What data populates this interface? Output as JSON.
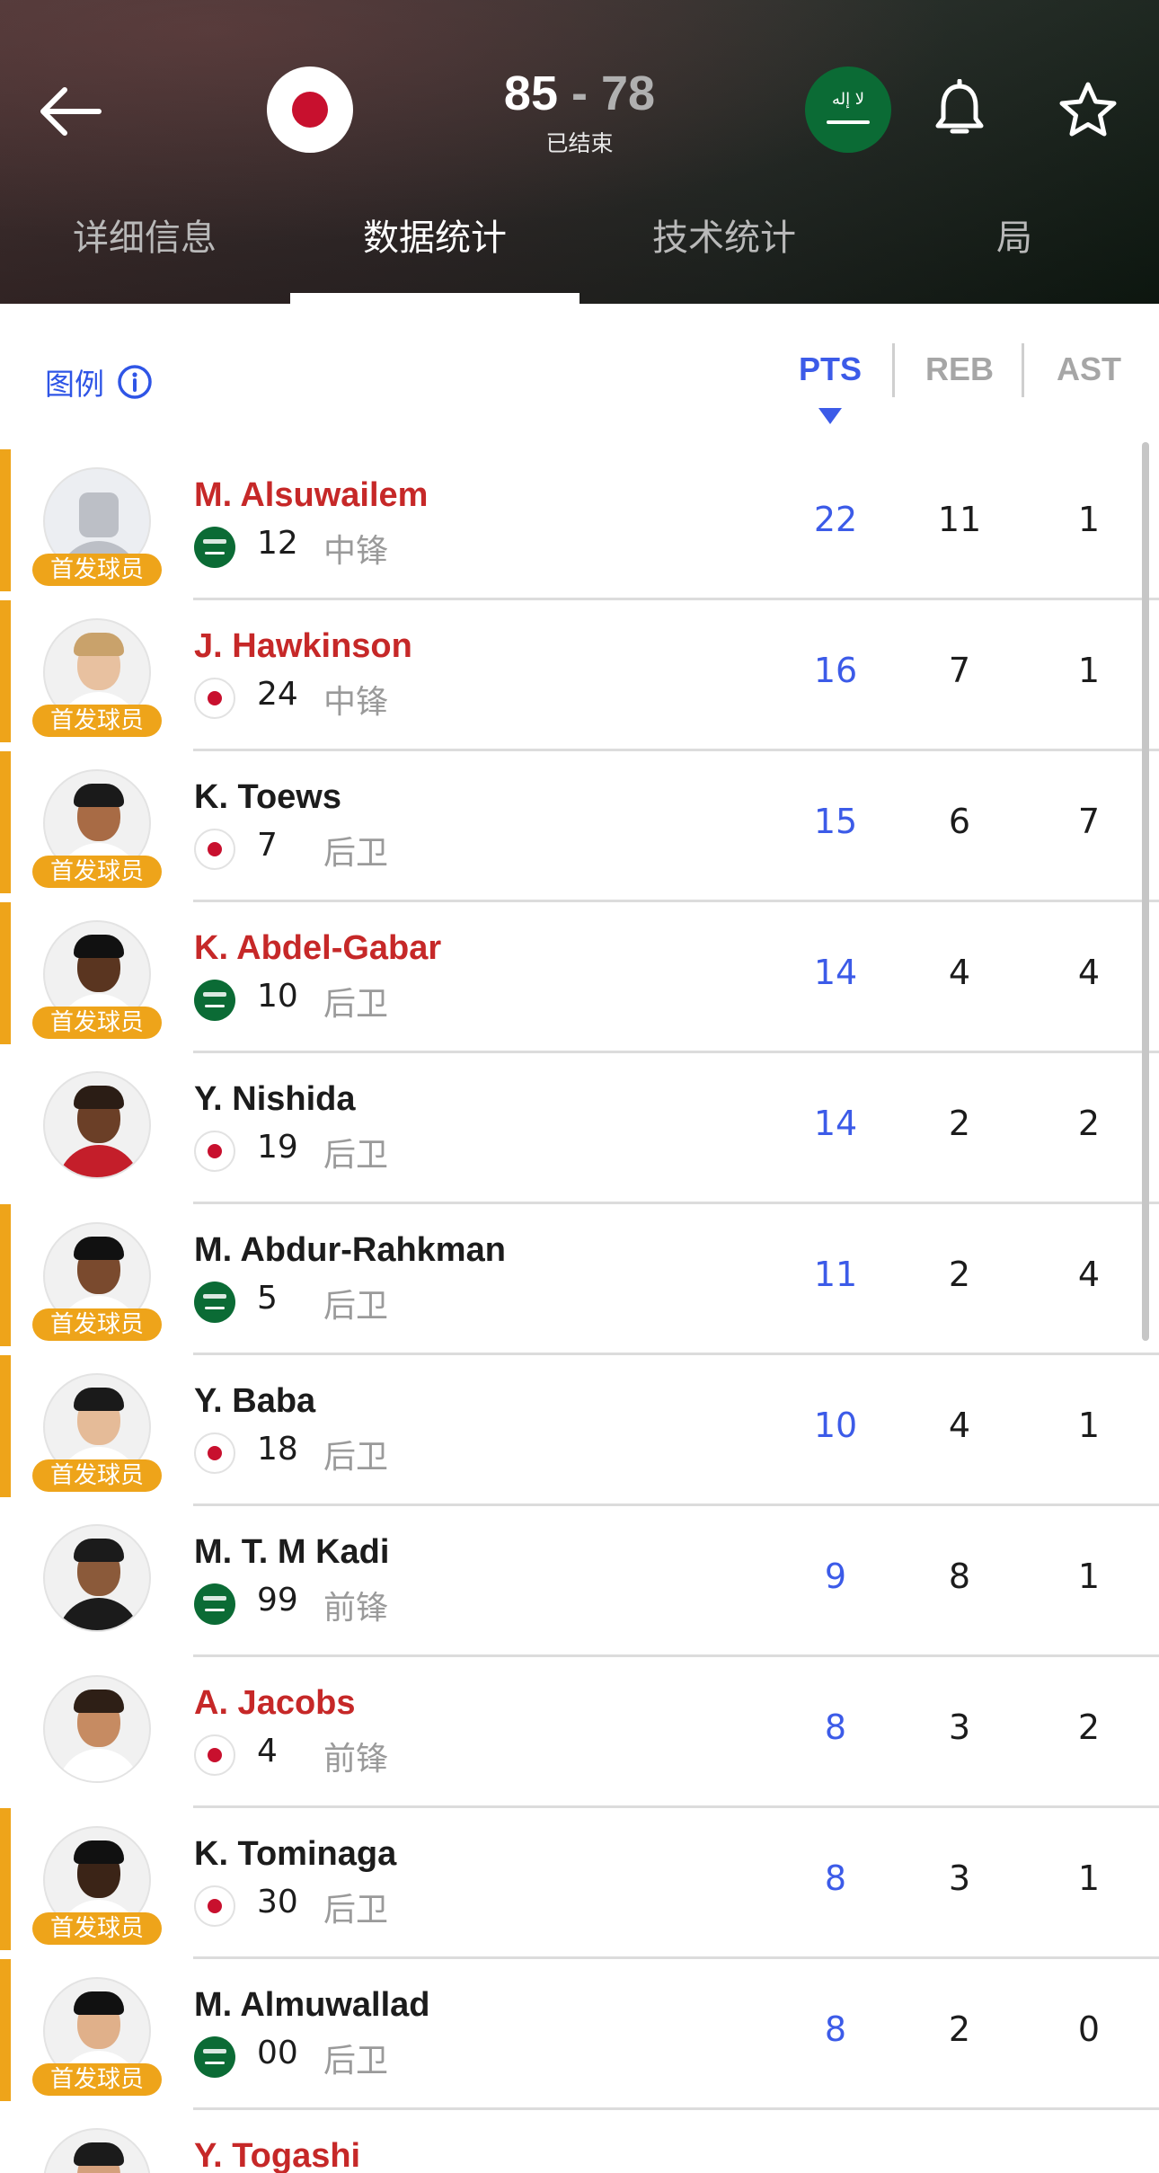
{
  "header": {
    "score_home": "85",
    "score_sep": " - ",
    "score_away": "78",
    "status": "已结束",
    "home_flag_color": "#c8102e",
    "away_logo_color": "#0b6b35",
    "away_logo_text": "ﻻ إله",
    "icons": {
      "back": "arrow-left-icon",
      "bell": "bell-icon",
      "star": "star-icon"
    }
  },
  "tabs": [
    {
      "label": "详细信息",
      "active": false
    },
    {
      "label": "数据统计",
      "active": true
    },
    {
      "label": "技术统计",
      "active": false
    },
    {
      "label": "局",
      "active": false
    }
  ],
  "list_header": {
    "legend_label": "图例",
    "columns": [
      {
        "label": "PTS",
        "active": true
      },
      {
        "label": "REB",
        "active": false
      },
      {
        "label": "AST",
        "active": false
      }
    ]
  },
  "badge_label": "首发球员",
  "players": [
    {
      "name": "M. Alsuwailem",
      "red": true,
      "team": "ksa",
      "number": "12",
      "position": "中锋",
      "starter": true,
      "pts": "22",
      "reb": "11",
      "ast": "1"
    },
    {
      "name": "J. Hawkinson",
      "red": true,
      "team": "jpn",
      "number": "24",
      "position": "中锋",
      "starter": true,
      "pts": "16",
      "reb": "7",
      "ast": "1"
    },
    {
      "name": "K. Toews",
      "red": false,
      "team": "jpn",
      "number": "7",
      "position": "后卫",
      "starter": true,
      "pts": "15",
      "reb": "6",
      "ast": "7"
    },
    {
      "name": "K. Abdel-Gabar",
      "red": true,
      "team": "ksa",
      "number": "10",
      "position": "后卫",
      "starter": true,
      "pts": "14",
      "reb": "4",
      "ast": "4"
    },
    {
      "name": "Y. Nishida",
      "red": false,
      "team": "jpn",
      "number": "19",
      "position": "后卫",
      "starter": false,
      "pts": "14",
      "reb": "2",
      "ast": "2"
    },
    {
      "name": "M. Abdur-Rahkman",
      "red": false,
      "team": "ksa",
      "number": "5",
      "position": "后卫",
      "starter": true,
      "pts": "11",
      "reb": "2",
      "ast": "4"
    },
    {
      "name": "Y. Baba",
      "red": false,
      "team": "jpn",
      "number": "18",
      "position": "后卫",
      "starter": true,
      "pts": "10",
      "reb": "4",
      "ast": "1"
    },
    {
      "name": "M. T. M Kadi",
      "red": false,
      "team": "ksa",
      "number": "99",
      "position": "前锋",
      "starter": false,
      "pts": "9",
      "reb": "8",
      "ast": "1"
    },
    {
      "name": "A. Jacobs",
      "red": true,
      "team": "jpn",
      "number": "4",
      "position": "前锋",
      "starter": false,
      "pts": "8",
      "reb": "3",
      "ast": "2"
    },
    {
      "name": "K. Tominaga",
      "red": false,
      "team": "jpn",
      "number": "30",
      "position": "后卫",
      "starter": true,
      "pts": "8",
      "reb": "3",
      "ast": "1"
    },
    {
      "name": "M. Almuwallad",
      "red": false,
      "team": "ksa",
      "number": "00",
      "position": "后卫",
      "starter": true,
      "pts": "8",
      "reb": "2",
      "ast": "0"
    },
    {
      "name": "Y. Togashi",
      "red": true,
      "team": "jpn",
      "number": "",
      "position": "",
      "starter": false,
      "pts": "",
      "reb": "",
      "ast": ""
    }
  ],
  "colors": {
    "accent_blue": "#3c5be8",
    "starter_orange": "#eea41a",
    "highlight_red": "#c62828"
  }
}
